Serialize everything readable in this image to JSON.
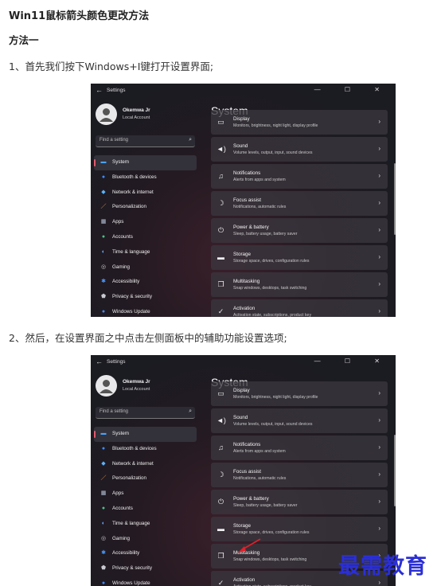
{
  "article": {
    "title": "Win11鼠标箭头颜色更改方法",
    "method": "方法一",
    "step1": "1、首先我们按下Windows+I键打开设置界面;",
    "step2": "2、然后，在设置界面之中点击左侧面板中的辅助功能设置选项;"
  },
  "settings": {
    "window_title": "Settings",
    "back_glyph": "←",
    "controls": "— ☐ ✕",
    "user_name": "Okemwa Jr",
    "user_account": "Local Account",
    "search_placeholder": "Find a setting",
    "main_title": "System",
    "nav": [
      {
        "label": "System",
        "icon": "display-icon",
        "glyph": "▬",
        "color": "#4aa3ff"
      },
      {
        "label": "Bluetooth & devices",
        "icon": "bluetooth-icon",
        "glyph": "●",
        "color": "#3f8cff"
      },
      {
        "label": "Network & internet",
        "icon": "wifi-icon",
        "glyph": "◆",
        "color": "#5ab4ff"
      },
      {
        "label": "Personalization",
        "icon": "brush-icon",
        "glyph": "／",
        "color": "#f0a050"
      },
      {
        "label": "Apps",
        "icon": "apps-icon",
        "glyph": "▦",
        "color": "#b8c4d8"
      },
      {
        "label": "Accounts",
        "icon": "person-icon",
        "glyph": "●",
        "color": "#4fc08a"
      },
      {
        "label": "Time & language",
        "icon": "globe-icon",
        "glyph": "◐",
        "color": "#6ab0ff"
      },
      {
        "label": "Gaming",
        "icon": "gamepad-icon",
        "glyph": "◎",
        "color": "#c8c8c8"
      },
      {
        "label": "Accessibility",
        "icon": "accessibility-icon",
        "glyph": "✱",
        "color": "#4a9aff"
      },
      {
        "label": "Privacy & security",
        "icon": "shield-icon",
        "glyph": "⬟",
        "color": "#c8c8d0"
      },
      {
        "label": "Windows Update",
        "icon": "update-icon",
        "glyph": "●",
        "color": "#3f8cff"
      }
    ],
    "cards": [
      {
        "title": "Display",
        "sub": "Monitors, brightness, night light, display profile",
        "icon": "monitor-icon",
        "glyph": "▭"
      },
      {
        "title": "Sound",
        "sub": "Volume levels, output, input, sound devices",
        "icon": "speaker-icon",
        "glyph": "◄)"
      },
      {
        "title": "Notifications",
        "sub": "Alerts from apps and system",
        "icon": "bell-icon",
        "glyph": "♫"
      },
      {
        "title": "Focus assist",
        "sub": "Notifications, automatic rules",
        "icon": "moon-icon",
        "glyph": "☽"
      },
      {
        "title": "Power & battery",
        "sub": "Sleep, battery usage, battery saver",
        "icon": "power-icon",
        "glyph": "⏻"
      },
      {
        "title": "Storage",
        "sub": "Storage space, drives, configuration rules",
        "icon": "drive-icon",
        "glyph": "▬"
      },
      {
        "title": "Multitasking",
        "sub": "Snap windows, desktops, task switching",
        "icon": "windows-icon",
        "glyph": "❐"
      },
      {
        "title": "Activation",
        "sub": "Activation state, subscriptions, product key",
        "icon": "check-circle-icon",
        "glyph": "✓"
      }
    ]
  },
  "watermark": "最需教育",
  "colors": {
    "accent": "#e05a6e",
    "arrow": "#e0202a",
    "watermark": "#2b2fd4"
  }
}
